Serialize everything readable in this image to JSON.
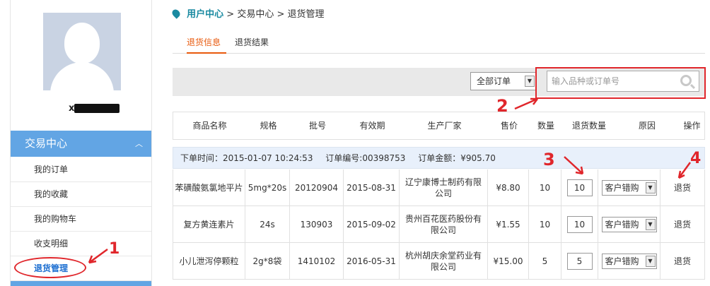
{
  "sidebar": {
    "username": "x",
    "menu_title": "交易中心",
    "items": [
      {
        "label": "我的订单"
      },
      {
        "label": "我的收藏"
      },
      {
        "label": "我的购物车"
      },
      {
        "label": "收支明细"
      },
      {
        "label": "退货管理"
      }
    ]
  },
  "breadcrumb": {
    "home": "用户中心",
    "sep1": ">",
    "level2": "交易中心",
    "sep2": ">",
    "current": "退货管理"
  },
  "tabs": [
    {
      "label": "退货信息",
      "active": true
    },
    {
      "label": "退货结果",
      "active": false
    }
  ],
  "filter": {
    "order_select": "全部订单",
    "search_placeholder": "输入品种或订单号"
  },
  "table": {
    "headers": [
      "商品名称",
      "规格",
      "批号",
      "有效期",
      "生产厂家",
      "售价",
      "数量",
      "退货数量",
      "原因",
      "操作"
    ],
    "order": {
      "time_label": "下单时间：2015-01-07 10:24:53",
      "number_label": "订单编号:00398753",
      "amount_label": "订单金额：¥905.70"
    },
    "rows": [
      {
        "name": "苯磺酸氨氯地平片",
        "spec": "5mg*20s",
        "batch": "20120904",
        "expiry": "2015-08-31",
        "maker": "辽宁康博士制药有限公司",
        "price": "¥8.80",
        "qty": "10",
        "return_qty": "10",
        "reason": "客户错购",
        "action": "退货"
      },
      {
        "name": "复方黄连素片",
        "spec": "24s",
        "batch": "130903",
        "expiry": "2015-09-02",
        "maker": "贵州百花医药股份有限公司",
        "price": "¥1.55",
        "qty": "10",
        "return_qty": "10",
        "reason": "客户错购",
        "action": "退货"
      },
      {
        "name": "小儿泄泻停颗粒",
        "spec": "2g*8袋",
        "batch": "1410102",
        "expiry": "2016-05-31",
        "maker": "杭州胡庆余堂药业有限公司",
        "price": "¥15.00",
        "qty": "5",
        "return_qty": "5",
        "reason": "客户错购",
        "action": "退货"
      }
    ]
  },
  "annotations": {
    "a1": "1",
    "a2": "2",
    "a3": "3",
    "a4": "4"
  },
  "colors": {
    "accent": "#62a5e4",
    "annotation": "#e0262b",
    "tab_active": "#e8590c",
    "breadcrumb_home": "#1a8aa1"
  }
}
